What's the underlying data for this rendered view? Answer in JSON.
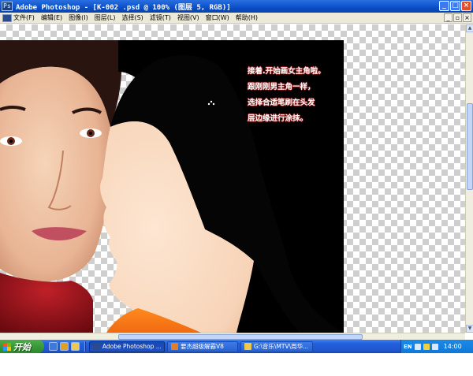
{
  "window": {
    "title": "Adobe Photoshop - [K-002 .psd @ 100% (图层 5, RGB)]",
    "logo_text": "Ps",
    "controls": {
      "minimize": "_",
      "maximize": "□",
      "close": "×"
    }
  },
  "menu": {
    "items": [
      "文件(F)",
      "编辑(E)",
      "图像(I)",
      "图层(L)",
      "选择(S)",
      "滤镜(T)",
      "视图(V)",
      "窗口(W)",
      "帮助(H)"
    ],
    "doc_controls": {
      "minimize": "_",
      "restore": "▫",
      "close": "×"
    }
  },
  "caption": {
    "lines": [
      "接着.开始画女主角啦。",
      "跟刚刚男主角一样，",
      "选择合适笔刷在头发",
      "层边缘进行涂抹。"
    ]
  },
  "taskbar": {
    "start_label": "开始",
    "tasks": [
      {
        "label": "Adobe Photoshop ...",
        "icon_color": "#2a4c8e"
      },
      {
        "label": "要杰超级解霸V8",
        "icon_color": "#e08020"
      },
      {
        "label": "G:\\音乐\\MTV\\周华...",
        "icon_color": "#f0c84a"
      }
    ],
    "tray": {
      "lang": "EN",
      "time": "14:00"
    }
  },
  "colors": {
    "titlebar": "#0a4fc8",
    "menubar": "#ece9d8",
    "taskbar": "#245edb",
    "start": "#3a9a38"
  }
}
